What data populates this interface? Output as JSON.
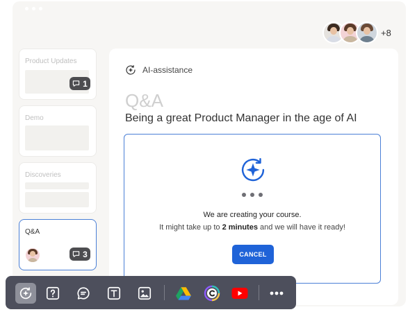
{
  "collaborators": {
    "avatars": [
      {
        "name": "avatar-1",
        "hair": "#3b2a20",
        "shirt": "#d9dde6",
        "bg": "#e5e2de"
      },
      {
        "name": "avatar-2",
        "hair": "#5a3a28",
        "shirt": "#c9b79f",
        "bg": "#f3d3d6"
      },
      {
        "name": "avatar-3",
        "hair": "#6a4a36",
        "shirt": "#6e7f8e",
        "bg": "#cfd6dd"
      }
    ],
    "more_count": "+8"
  },
  "sidebar": {
    "cards": [
      {
        "label": "Product Updates",
        "comments": "1"
      },
      {
        "label": "Demo"
      },
      {
        "label": "Discoveries"
      },
      {
        "label": "Q&A",
        "comments": "3"
      }
    ]
  },
  "main": {
    "header_label": "AI-assistance",
    "title": "Q&A",
    "subtitle": "Being a great Product Manager in the age of AI"
  },
  "progress": {
    "message": "We are creating your course.",
    "sub_before": "It might take up to ",
    "sub_bold": "2 minutes",
    "sub_after": " and we will have it ready!",
    "cancel_label": "CANCEL"
  },
  "toolbar": {
    "tools": [
      "ai-assist-icon",
      "question-icon",
      "chat-icon",
      "text-icon",
      "image-icon",
      "google-drive-icon",
      "canva-icon",
      "youtube-icon",
      "more-icon"
    ]
  },
  "colors": {
    "accent": "#1f63d8",
    "toolbar_bg": "#4d4f5c",
    "badge_bg": "#4d4d50"
  }
}
